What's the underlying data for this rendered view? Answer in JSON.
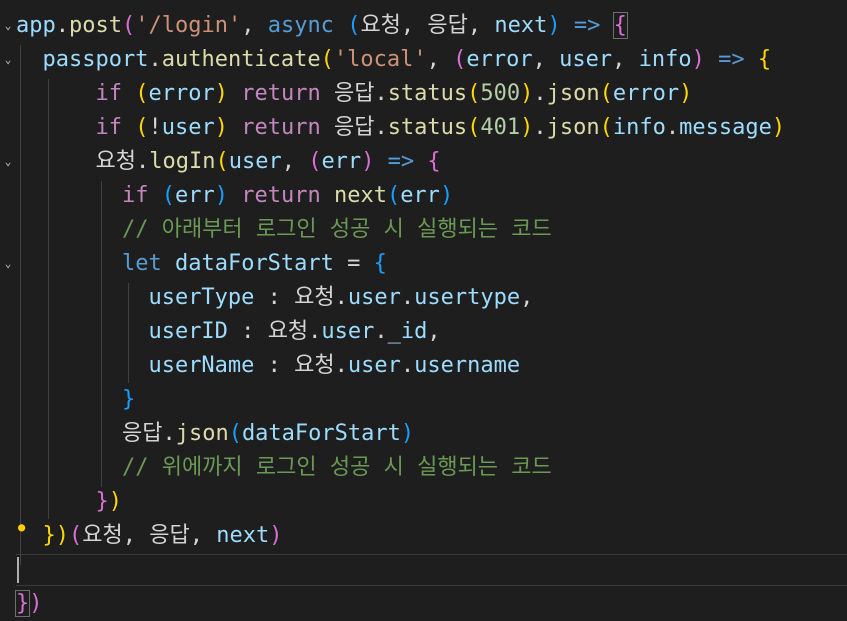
{
  "editor": {
    "lines": [
      {
        "tokens": [
          {
            "t": "app",
            "c": "t-var"
          },
          {
            "t": ".",
            "c": "t-text"
          },
          {
            "t": "post",
            "c": "t-yellow"
          },
          {
            "t": "(",
            "c": "t-brace2"
          },
          {
            "t": "'/login'",
            "c": "t-string"
          },
          {
            "t": ", ",
            "c": "t-text"
          },
          {
            "t": "async",
            "c": "t-blue"
          },
          {
            "t": " ",
            "c": "t-text"
          },
          {
            "t": "(",
            "c": "t-brace3"
          },
          {
            "t": "요청",
            "c": "t-ko"
          },
          {
            "t": ", ",
            "c": "t-text"
          },
          {
            "t": "응답",
            "c": "t-ko"
          },
          {
            "t": ", ",
            "c": "t-text"
          },
          {
            "t": "next",
            "c": "t-var"
          },
          {
            "t": ")",
            "c": "t-brace3"
          },
          {
            "t": " => ",
            "c": "t-blue"
          },
          {
            "t": "{",
            "c": "t-brace2 box"
          }
        ]
      },
      {
        "tokens": [
          {
            "t": "  ",
            "c": "t-text"
          },
          {
            "t": "passport",
            "c": "t-var"
          },
          {
            "t": ".",
            "c": "t-text"
          },
          {
            "t": "authenticate",
            "c": "t-yellow"
          },
          {
            "t": "(",
            "c": "t-brace1"
          },
          {
            "t": "'local'",
            "c": "t-string"
          },
          {
            "t": ", ",
            "c": "t-text"
          },
          {
            "t": "(",
            "c": "t-brace2"
          },
          {
            "t": "error",
            "c": "t-var"
          },
          {
            "t": ", ",
            "c": "t-text"
          },
          {
            "t": "user",
            "c": "t-var"
          },
          {
            "t": ", ",
            "c": "t-text"
          },
          {
            "t": "info",
            "c": "t-var"
          },
          {
            "t": ")",
            "c": "t-brace2"
          },
          {
            "t": " => ",
            "c": "t-blue"
          },
          {
            "t": "{",
            "c": "t-brace1"
          }
        ]
      },
      {
        "tokens": [
          {
            "t": "      ",
            "c": "t-text"
          },
          {
            "t": "if",
            "c": "t-purple"
          },
          {
            "t": " ",
            "c": "t-text"
          },
          {
            "t": "(",
            "c": "t-brace1"
          },
          {
            "t": "error",
            "c": "t-var"
          },
          {
            "t": ")",
            "c": "t-brace1"
          },
          {
            "t": " ",
            "c": "t-text"
          },
          {
            "t": "return",
            "c": "t-purple"
          },
          {
            "t": " ",
            "c": "t-text"
          },
          {
            "t": "응답",
            "c": "t-ko"
          },
          {
            "t": ".",
            "c": "t-text"
          },
          {
            "t": "status",
            "c": "t-yellow"
          },
          {
            "t": "(",
            "c": "t-brace1"
          },
          {
            "t": "500",
            "c": "t-number"
          },
          {
            "t": ")",
            "c": "t-brace1"
          },
          {
            "t": ".",
            "c": "t-text"
          },
          {
            "t": "json",
            "c": "t-yellow"
          },
          {
            "t": "(",
            "c": "t-brace1"
          },
          {
            "t": "error",
            "c": "t-var"
          },
          {
            "t": ")",
            "c": "t-brace1"
          }
        ]
      },
      {
        "tokens": [
          {
            "t": "      ",
            "c": "t-text"
          },
          {
            "t": "if",
            "c": "t-purple"
          },
          {
            "t": " ",
            "c": "t-text"
          },
          {
            "t": "(",
            "c": "t-brace1"
          },
          {
            "t": "!",
            "c": "t-text"
          },
          {
            "t": "user",
            "c": "t-var"
          },
          {
            "t": ")",
            "c": "t-brace1"
          },
          {
            "t": " ",
            "c": "t-text"
          },
          {
            "t": "return",
            "c": "t-purple"
          },
          {
            "t": " ",
            "c": "t-text"
          },
          {
            "t": "응답",
            "c": "t-ko"
          },
          {
            "t": ".",
            "c": "t-text"
          },
          {
            "t": "status",
            "c": "t-yellow"
          },
          {
            "t": "(",
            "c": "t-brace1"
          },
          {
            "t": "401",
            "c": "t-number"
          },
          {
            "t": ")",
            "c": "t-brace1"
          },
          {
            "t": ".",
            "c": "t-text"
          },
          {
            "t": "json",
            "c": "t-yellow"
          },
          {
            "t": "(",
            "c": "t-brace1"
          },
          {
            "t": "info",
            "c": "t-var"
          },
          {
            "t": ".",
            "c": "t-text"
          },
          {
            "t": "message",
            "c": "t-var"
          },
          {
            "t": ")",
            "c": "t-brace1"
          }
        ]
      },
      {
        "tokens": [
          {
            "t": "      ",
            "c": "t-text"
          },
          {
            "t": "요청",
            "c": "t-ko"
          },
          {
            "t": ".",
            "c": "t-text"
          },
          {
            "t": "logIn",
            "c": "t-yellow"
          },
          {
            "t": "(",
            "c": "t-brace1"
          },
          {
            "t": "user",
            "c": "t-var"
          },
          {
            "t": ", ",
            "c": "t-text"
          },
          {
            "t": "(",
            "c": "t-brace2"
          },
          {
            "t": "err",
            "c": "t-var"
          },
          {
            "t": ")",
            "c": "t-brace2"
          },
          {
            "t": " => ",
            "c": "t-blue"
          },
          {
            "t": "{",
            "c": "t-brace2"
          }
        ]
      },
      {
        "tokens": [
          {
            "t": "        ",
            "c": "t-text"
          },
          {
            "t": "if",
            "c": "t-purple"
          },
          {
            "t": " ",
            "c": "t-text"
          },
          {
            "t": "(",
            "c": "t-brace3"
          },
          {
            "t": "err",
            "c": "t-var"
          },
          {
            "t": ")",
            "c": "t-brace3"
          },
          {
            "t": " ",
            "c": "t-text"
          },
          {
            "t": "return",
            "c": "t-purple"
          },
          {
            "t": " ",
            "c": "t-text"
          },
          {
            "t": "next",
            "c": "t-yellow"
          },
          {
            "t": "(",
            "c": "t-brace3"
          },
          {
            "t": "err",
            "c": "t-var"
          },
          {
            "t": ")",
            "c": "t-brace3"
          }
        ]
      },
      {
        "tokens": [
          {
            "t": "        ",
            "c": "t-text"
          },
          {
            "t": "// 아래부터 로그인 성공 시 실행되는 코드",
            "c": "t-comment"
          }
        ]
      },
      {
        "tokens": [
          {
            "t": "        ",
            "c": "t-text"
          },
          {
            "t": "let",
            "c": "t-blue"
          },
          {
            "t": " ",
            "c": "t-text"
          },
          {
            "t": "dataForStart",
            "c": "t-var"
          },
          {
            "t": " = ",
            "c": "t-text"
          },
          {
            "t": "{",
            "c": "t-brace3"
          }
        ]
      },
      {
        "tokens": [
          {
            "t": "          ",
            "c": "t-text"
          },
          {
            "t": "userType",
            "c": "t-var"
          },
          {
            "t": " : ",
            "c": "t-text"
          },
          {
            "t": "요청",
            "c": "t-ko"
          },
          {
            "t": ".",
            "c": "t-text"
          },
          {
            "t": "user",
            "c": "t-var"
          },
          {
            "t": ".",
            "c": "t-text"
          },
          {
            "t": "usertype",
            "c": "t-var"
          },
          {
            "t": ",",
            "c": "t-text"
          }
        ]
      },
      {
        "tokens": [
          {
            "t": "          ",
            "c": "t-text"
          },
          {
            "t": "userID",
            "c": "t-var"
          },
          {
            "t": " : ",
            "c": "t-text"
          },
          {
            "t": "요청",
            "c": "t-ko"
          },
          {
            "t": ".",
            "c": "t-text"
          },
          {
            "t": "user",
            "c": "t-var"
          },
          {
            "t": ".",
            "c": "t-text"
          },
          {
            "t": "_id",
            "c": "t-var"
          },
          {
            "t": ",",
            "c": "t-text"
          }
        ]
      },
      {
        "tokens": [
          {
            "t": "          ",
            "c": "t-text"
          },
          {
            "t": "userName",
            "c": "t-var"
          },
          {
            "t": " : ",
            "c": "t-text"
          },
          {
            "t": "요청",
            "c": "t-ko"
          },
          {
            "t": ".",
            "c": "t-text"
          },
          {
            "t": "user",
            "c": "t-var"
          },
          {
            "t": ".",
            "c": "t-text"
          },
          {
            "t": "username",
            "c": "t-var"
          }
        ]
      },
      {
        "tokens": [
          {
            "t": "        ",
            "c": "t-text"
          },
          {
            "t": "}",
            "c": "t-brace3"
          }
        ]
      },
      {
        "tokens": [
          {
            "t": "        ",
            "c": "t-text"
          },
          {
            "t": "응답",
            "c": "t-ko"
          },
          {
            "t": ".",
            "c": "t-text"
          },
          {
            "t": "json",
            "c": "t-yellow"
          },
          {
            "t": "(",
            "c": "t-brace3"
          },
          {
            "t": "dataForStart",
            "c": "t-var"
          },
          {
            "t": ")",
            "c": "t-brace3"
          }
        ]
      },
      {
        "tokens": [
          {
            "t": "        ",
            "c": "t-text"
          },
          {
            "t": "// 위에까지 로그인 성공 시 실행되는 코드",
            "c": "t-comment"
          }
        ]
      },
      {
        "tokens": [
          {
            "t": "      ",
            "c": "t-text"
          },
          {
            "t": "}",
            "c": "t-brace2"
          },
          {
            "t": ")",
            "c": "t-brace1"
          }
        ]
      },
      {
        "tokens": [
          {
            "t": "  ",
            "c": "t-text"
          },
          {
            "t": "}",
            "c": "t-brace1"
          },
          {
            "t": ")",
            "c": "t-brace1"
          },
          {
            "t": "(",
            "c": "t-brace2"
          },
          {
            "t": "요청",
            "c": "t-ko"
          },
          {
            "t": ", ",
            "c": "t-text"
          },
          {
            "t": "응답",
            "c": "t-ko"
          },
          {
            "t": ", ",
            "c": "t-text"
          },
          {
            "t": "next",
            "c": "t-var"
          },
          {
            "t": ")",
            "c": "t-brace2"
          }
        ]
      },
      {
        "tokens": [
          {
            "t": "",
            "c": "t-text"
          }
        ]
      },
      {
        "tokens": [
          {
            "t": "}",
            "c": "t-brace2 box"
          },
          {
            "t": ")",
            "c": "t-brace2"
          }
        ]
      }
    ]
  },
  "gutter": {
    "fold_icon": "chevron-down-icon",
    "lightbulb_icon": "lightbulb-icon"
  }
}
